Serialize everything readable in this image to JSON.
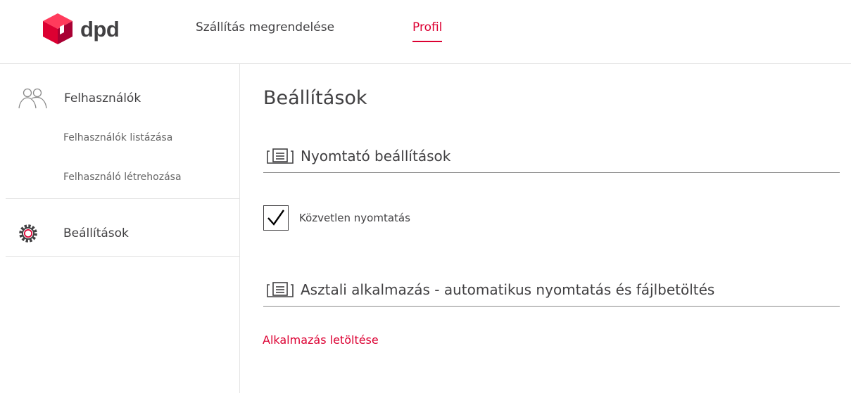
{
  "header": {
    "logo_text": "dpd",
    "nav": [
      {
        "label": "Szállítás megrendelése"
      },
      {
        "label": "Profil"
      }
    ],
    "active_nav": "Profil"
  },
  "sidebar": {
    "users": {
      "label": "Felhasználók",
      "icon": "users-icon",
      "items": [
        {
          "label": "Felhasználók listázása"
        },
        {
          "label": "Felhasználó létrehozása"
        }
      ]
    },
    "settings": {
      "label": "Beállítások",
      "icon": "gear-icon"
    }
  },
  "main": {
    "title": "Beállítások",
    "printer_section": {
      "title": "Nyomtató beállítások",
      "icon": "printer-icon",
      "direct_print": {
        "label": "Közvetlen nyomtatás",
        "checked": true
      }
    },
    "desktop_section": {
      "title": "Asztali alkalmazás - automatikus nyomtatás és fájlbetöltés",
      "icon": "printer-icon",
      "download_link": "Alkalmazás letöltése"
    }
  },
  "colors": {
    "brand": "#dc0032",
    "text": "#414042",
    "divider": "#e4e4e4"
  }
}
